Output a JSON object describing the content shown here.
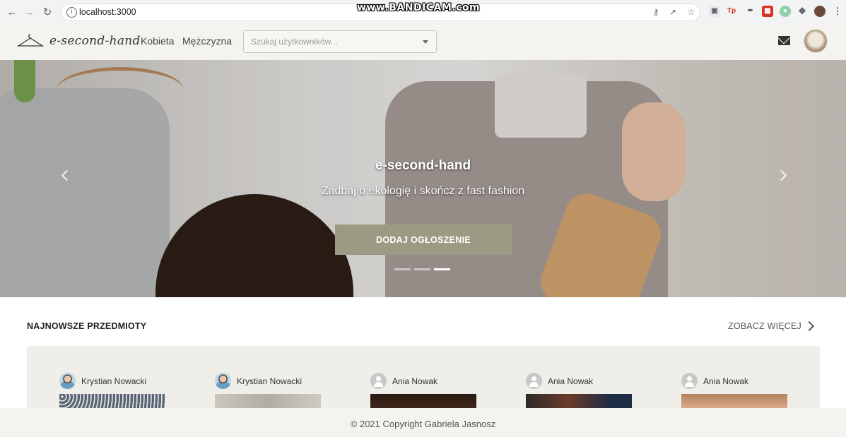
{
  "browser": {
    "url": "localhost:3000",
    "watermark": "www.BANDICAM.com"
  },
  "header": {
    "logo_text": "e-second-hand",
    "nav": [
      {
        "label": "Kobieta"
      },
      {
        "label": "Mężczyzna"
      }
    ],
    "search_placeholder": "Szukaj użytkowników..."
  },
  "hero": {
    "title": "e-second-hand",
    "subtitle": "Zadbaj o ekologię i skończ z fast fashion",
    "button_label": "DODAJ OGŁOSZENIE",
    "slides_count": 3,
    "active_slide": 3
  },
  "newest": {
    "title": "NAJNOWSZE PRZEDMIOTY",
    "see_more": "ZOBACZ WIĘCEJ",
    "items": [
      {
        "user": "Krystian Nowacki",
        "avatar": "photo"
      },
      {
        "user": "Krystian Nowacki",
        "avatar": "photo"
      },
      {
        "user": "Ania Nowak",
        "avatar": "default"
      },
      {
        "user": "Ania Nowak",
        "avatar": "default"
      },
      {
        "user": "Ania Nowak",
        "avatar": "default"
      }
    ]
  },
  "footer": {
    "copyright": "© 2021 Copyright Gabriela Jasnosz"
  },
  "colors": {
    "header_bg": "#f4f3ef",
    "accent_button": "#9c9a83",
    "panel_bg": "#efeee9"
  }
}
